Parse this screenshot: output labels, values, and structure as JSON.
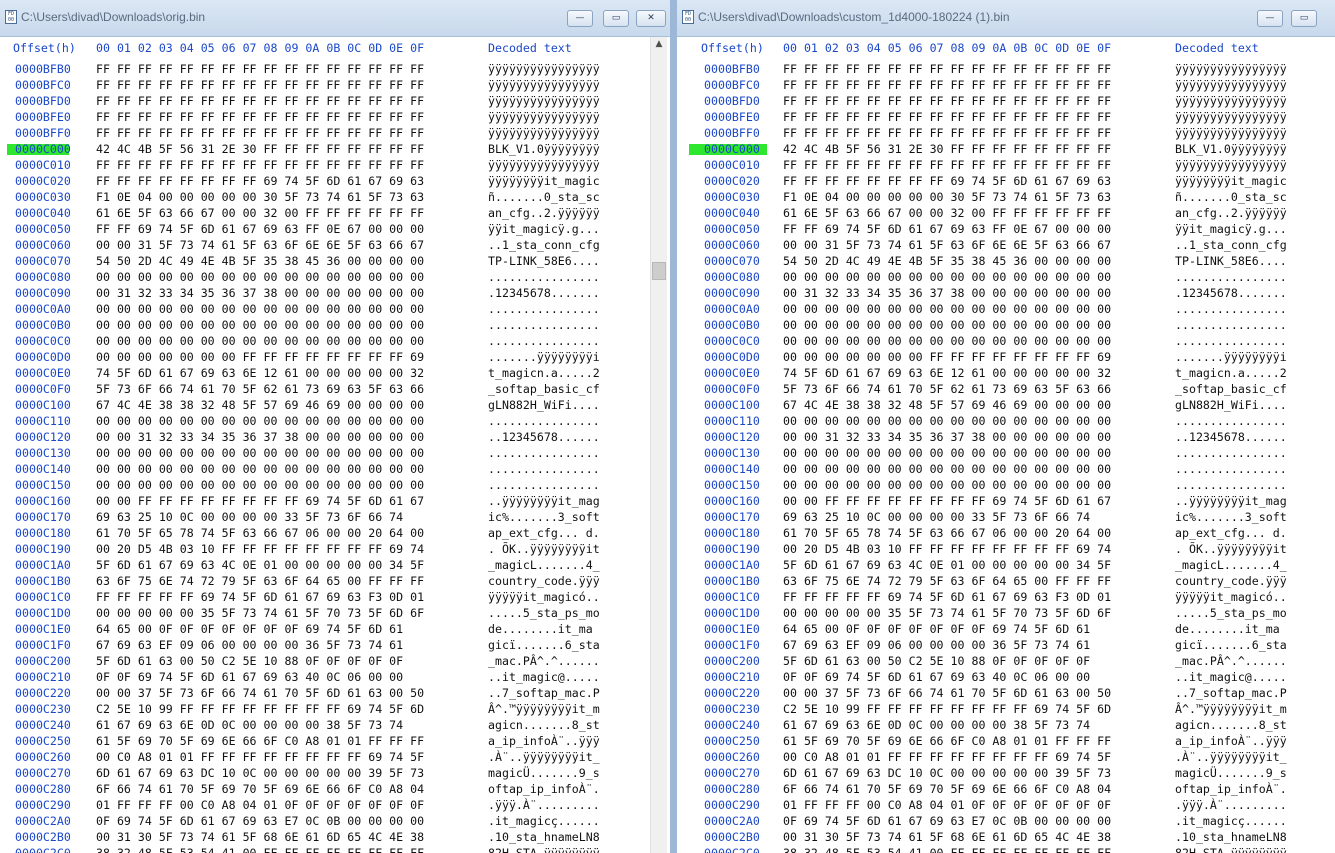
{
  "left": {
    "title": "C:\\Users\\divad\\Downloads\\orig.bin",
    "has_scrollbar": true
  },
  "right": {
    "title": "C:\\Users\\divad\\Downloads\\custom_1d4000-180224 (1).bin",
    "has_scrollbar": false
  },
  "controls": {
    "minimize": "—",
    "maximize": "▭",
    "close": "✕"
  },
  "app_icon_label": "FD 00",
  "header": {
    "offset": "Offset(h)",
    "hex": "00 01 02 03 04 05 06 07 08 09 0A 0B 0C 0D 0E 0F",
    "decoded": "Decoded text"
  },
  "highlight_color": "#2ee62e",
  "highlight_row": "0000C000",
  "rows": [
    {
      "off": "0000BFB0",
      "hex": "FF FF FF FF FF FF FF FF FF FF FF FF FF FF FF FF",
      "dec": "ÿÿÿÿÿÿÿÿÿÿÿÿÿÿÿÿ"
    },
    {
      "off": "0000BFC0",
      "hex": "FF FF FF FF FF FF FF FF FF FF FF FF FF FF FF FF",
      "dec": "ÿÿÿÿÿÿÿÿÿÿÿÿÿÿÿÿ"
    },
    {
      "off": "0000BFD0",
      "hex": "FF FF FF FF FF FF FF FF FF FF FF FF FF FF FF FF",
      "dec": "ÿÿÿÿÿÿÿÿÿÿÿÿÿÿÿÿ"
    },
    {
      "off": "0000BFE0",
      "hex": "FF FF FF FF FF FF FF FF FF FF FF FF FF FF FF FF",
      "dec": "ÿÿÿÿÿÿÿÿÿÿÿÿÿÿÿÿ"
    },
    {
      "off": "0000BFF0",
      "hex": "FF FF FF FF FF FF FF FF FF FF FF FF FF FF FF FF",
      "dec": "ÿÿÿÿÿÿÿÿÿÿÿÿÿÿÿÿ"
    },
    {
      "off": "0000C000",
      "hex": "42 4C 4B 5F 56 31 2E 30 FF FF FF FF FF FF FF FF",
      "dec": "BLK_V1.0ÿÿÿÿÿÿÿÿ"
    },
    {
      "off": "0000C010",
      "hex": "FF FF FF FF FF FF FF FF FF FF FF FF FF FF FF FF",
      "dec": "ÿÿÿÿÿÿÿÿÿÿÿÿÿÿÿÿ"
    },
    {
      "off": "0000C020",
      "hex": "FF FF FF FF FF FF FF FF 69 74 5F 6D 61 67 69 63",
      "dec": "ÿÿÿÿÿÿÿÿit_magic"
    },
    {
      "off": "0000C030",
      "hex": "F1 0E 04 00 00 00 00 00 30 5F 73 74 61 5F 73 63",
      "dec": "ñ.......0_sta_sc"
    },
    {
      "off": "0000C040",
      "hex": "61 6E 5F 63 66 67 00 00 32 00 FF FF FF FF FF FF",
      "dec": "an_cfg..2.ÿÿÿÿÿÿ"
    },
    {
      "off": "0000C050",
      "hex": "FF FF 69 74 5F 6D 61 67 69 63 FF 0E 67 00 00 00",
      "dec": "ÿÿit_magicÿ.g..."
    },
    {
      "off": "0000C060",
      "hex": "00 00 31 5F 73 74 61 5F 63 6F 6E 6E 5F 63 66 67",
      "dec": "..1_sta_conn_cfg"
    },
    {
      "off": "0000C070",
      "hex": "54 50 2D 4C 49 4E 4B 5F 35 38 45 36 00 00 00 00",
      "dec": "TP-LINK_58E6...."
    },
    {
      "off": "0000C080",
      "hex": "00 00 00 00 00 00 00 00 00 00 00 00 00 00 00 00",
      "dec": "................"
    },
    {
      "off": "0000C090",
      "hex": "00 31 32 33 34 35 36 37 38 00 00 00 00 00 00 00",
      "dec": ".12345678......."
    },
    {
      "off": "0000C0A0",
      "hex": "00 00 00 00 00 00 00 00 00 00 00 00 00 00 00 00",
      "dec": "................"
    },
    {
      "off": "0000C0B0",
      "hex": "00 00 00 00 00 00 00 00 00 00 00 00 00 00 00 00",
      "dec": "................"
    },
    {
      "off": "0000C0C0",
      "hex": "00 00 00 00 00 00 00 00 00 00 00 00 00 00 00 00",
      "dec": "................"
    },
    {
      "off": "0000C0D0",
      "hex": "00 00 00 00 00 00 00 FF FF FF FF FF FF FF FF 69",
      "dec": ".......ÿÿÿÿÿÿÿÿi"
    },
    {
      "off": "0000C0E0",
      "hex": "74 5F 6D 61 67 69 63 6E 12 61 00 00 00 00 00 32",
      "dec": "t_magicn.a.....2"
    },
    {
      "off": "0000C0F0",
      "hex": "5F 73 6F 66 74 61 70 5F 62 61 73 69 63 5F 63 66",
      "dec": "_softap_basic_cf"
    },
    {
      "off": "0000C100",
      "hex": "67 4C 4E 38 38 32 48 5F 57 69 46 69 00 00 00 00",
      "dec": "gLN882H_WiFi...."
    },
    {
      "off": "0000C110",
      "hex": "00 00 00 00 00 00 00 00 00 00 00 00 00 00 00 00",
      "dec": "................"
    },
    {
      "off": "0000C120",
      "hex": "00 00 31 32 33 34 35 36 37 38 00 00 00 00 00 00",
      "dec": "..12345678......"
    },
    {
      "off": "0000C130",
      "hex": "00 00 00 00 00 00 00 00 00 00 00 00 00 00 00 00",
      "dec": "................"
    },
    {
      "off": "0000C140",
      "hex": "00 00 00 00 00 00 00 00 00 00 00 00 00 00 00 00",
      "dec": "................"
    },
    {
      "off": "0000C150",
      "hex": "00 00 00 00 00 00 00 00 00 00 00 00 00 00 00 00",
      "dec": "................"
    },
    {
      "off": "0000C160",
      "hex": "00 00 FF FF FF FF FF FF FF FF 69 74 5F 6D 61 67",
      "dec": "..ÿÿÿÿÿÿÿÿit_mag"
    },
    {
      "off": "0000C170",
      "hex": "69 63 25 10 0C 00 00 00 00 33 5F 73 6F 66 74",
      "dec": "ic%.......3_soft"
    },
    {
      "off": "0000C180",
      "hex": "61 70 5F 65 78 74 5F 63 66 67 06 00 00 20 64 00",
      "dec": "ap_ext_cfg... d."
    },
    {
      "off": "0000C190",
      "hex": "00 20 D5 4B 03 10 FF FF FF FF FF FF FF FF 69 74",
      "dec": ". ÕK..ÿÿÿÿÿÿÿÿit"
    },
    {
      "off": "0000C1A0",
      "hex": "5F 6D 61 67 69 63 4C 0E 01 00 00 00 00 00 34 5F",
      "dec": "_magicL.......4_"
    },
    {
      "off": "0000C1B0",
      "hex": "63 6F 75 6E 74 72 79 5F 63 6F 64 65 00 FF FF FF",
      "dec": "country_code.ÿÿÿ"
    },
    {
      "off": "0000C1C0",
      "hex": "FF FF FF FF FF 69 74 5F 6D 61 67 69 63 F3 0D 01",
      "dec": "ÿÿÿÿÿit_magicó.."
    },
    {
      "off": "0000C1D0",
      "hex": "00 00 00 00 00 35 5F 73 74 61 5F 70 73 5F 6D 6F",
      "dec": ".....5_sta_ps_mo"
    },
    {
      "off": "0000C1E0",
      "hex": "64 65 00 0F 0F 0F 0F 0F 0F 0F 69 74 5F 6D 61",
      "dec": "de........it_ma"
    },
    {
      "off": "0000C1F0",
      "hex": "67 69 63 EF 09 06 00 00 00 00 36 5F 73 74 61",
      "dec": "gicï.......6_sta"
    },
    {
      "off": "0000C200",
      "hex": "5F 6D 61 63 00 50 C2 5E 10 88 0F 0F 0F 0F 0F",
      "dec": "_mac.PÂ^.^......"
    },
    {
      "off": "0000C210",
      "hex": "0F 0F 69 74 5F 6D 61 67 69 63 40 0C 06 00 00",
      "dec": "..it_magic@....."
    },
    {
      "off": "0000C220",
      "hex": "00 00 37 5F 73 6F 66 74 61 70 5F 6D 61 63 00 50",
      "dec": "..7_softap_mac.P"
    },
    {
      "off": "0000C230",
      "hex": "C2 5E 10 99 FF FF FF FF FF FF FF FF 69 74 5F 6D",
      "dec": "Â^.™ÿÿÿÿÿÿÿÿit_m"
    },
    {
      "off": "0000C240",
      "hex": "61 67 69 63 6E 0D 0C 00 00 00 00 38 5F 73 74",
      "dec": "agicn.......8_st"
    },
    {
      "off": "0000C250",
      "hex": "61 5F 69 70 5F 69 6E 66 6F C0 A8 01 01 FF FF FF",
      "dec": "a_ip_infoÀ¨..ÿÿÿ"
    },
    {
      "off": "0000C260",
      "hex": "00 C0 A8 01 01 FF FF FF FF FF FF FF FF 69 74 5F",
      "dec": ".À¨..ÿÿÿÿÿÿÿÿit_"
    },
    {
      "off": "0000C270",
      "hex": "6D 61 67 69 63 DC 10 0C 00 00 00 00 00 39 5F 73",
      "dec": "magicÜ.......9_s"
    },
    {
      "off": "0000C280",
      "hex": "6F 66 74 61 70 5F 69 70 5F 69 6E 66 6F C0 A8 04",
      "dec": "oftap_ip_infoÀ¨."
    },
    {
      "off": "0000C290",
      "hex": "01 FF FF FF 00 C0 A8 04 01 0F 0F 0F 0F 0F 0F 0F",
      "dec": ".ÿÿÿ.À¨........."
    },
    {
      "off": "0000C2A0",
      "hex": "0F 69 74 5F 6D 61 67 69 63 E7 0C 0B 00 00 00 00",
      "dec": ".it_magicç......"
    },
    {
      "off": "0000C2B0",
      "hex": "00 31 30 5F 73 74 61 5F 68 6E 61 6D 65 4C 4E 38",
      "dec": ".10_sta_hnameLN8"
    },
    {
      "off": "0000C2C0",
      "hex": "38 32 48 5F 53 54 41 00 FF FF FF FF FF FF FF FF",
      "dec": "82H_STA.ÿÿÿÿÿÿÿÿ"
    }
  ]
}
